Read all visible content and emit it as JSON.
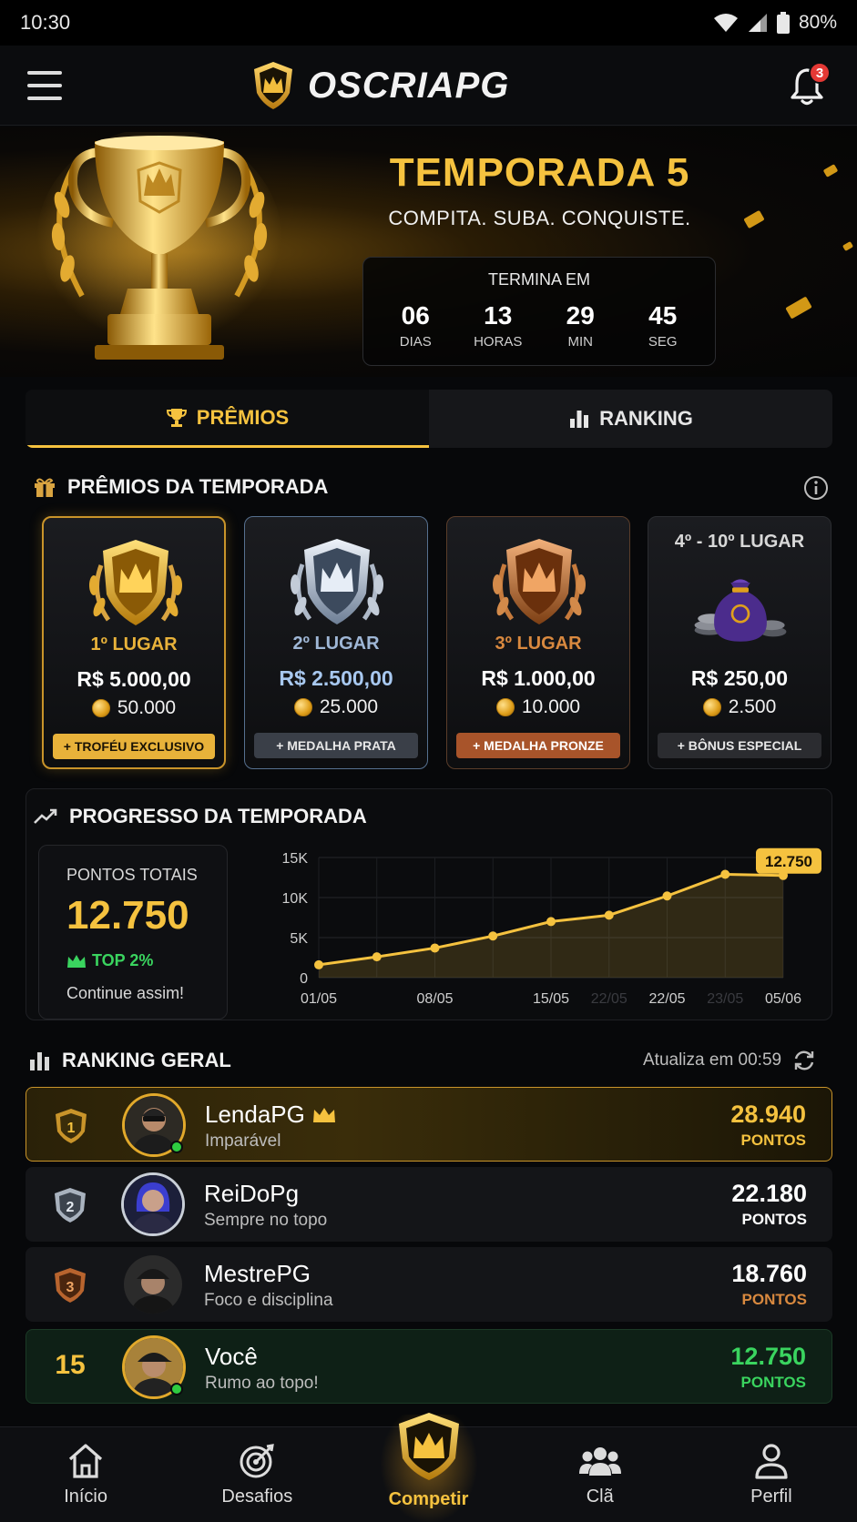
{
  "status_bar": {
    "time": "10:30",
    "battery": "80%"
  },
  "header": {
    "brand": "OSCRIAPG",
    "notifications": "3"
  },
  "hero": {
    "title": "TEMPORADA 5",
    "subtitle": "COMPITA. SUBA. CONQUISTE.",
    "countdown": {
      "label": "TERMINA EM",
      "units": [
        {
          "value": "06",
          "name": "DIAS"
        },
        {
          "value": "13",
          "name": "HORAS"
        },
        {
          "value": "29",
          "name": "MIN"
        },
        {
          "value": "45",
          "name": "SEG"
        }
      ]
    }
  },
  "tabs": [
    {
      "label": "PRÊMIOS",
      "active": true
    },
    {
      "label": "RANKING",
      "active": false
    }
  ],
  "prizes": {
    "title": "PRÊMIOS DA TEMPORADA",
    "cards": [
      {
        "rank": "1º LUGAR",
        "money": "R$ 5.000,00",
        "coins": "50.000",
        "badge": "+ TROFÉU EXCLUSIVO",
        "rank_color": "#e8b23a",
        "money_color": "#ffffff"
      },
      {
        "rank": "2º LUGAR",
        "money": "R$ 2.500,00",
        "coins": "25.000",
        "badge": "+ MEDALHA PRATA",
        "rank_color": "#9fb7d6",
        "money_color": "#a8c8f0"
      },
      {
        "rank": "3º LUGAR",
        "money": "R$ 1.000,00",
        "coins": "10.000",
        "badge": "+ MEDALHA PRONZE",
        "rank_color": "#d9893f",
        "money_color": "#ffffff"
      },
      {
        "rank": "4º - 10º LUGAR",
        "money": "R$ 250,00",
        "coins": "2.500",
        "badge": "+ BÔNUS ESPECIAL",
        "rank_color": "#d8d8d8",
        "money_color": "#ffffff"
      }
    ]
  },
  "progress": {
    "title": "PROGRESSO DA TEMPORADA",
    "points_label": "PONTOS TOTAIS",
    "points_value": "12.750",
    "top": "TOP 2%",
    "message": "Continue assim!"
  },
  "chart_data": {
    "type": "area",
    "x_labels": [
      "01/05",
      "08/05",
      "15/05",
      "22/05",
      "05/06"
    ],
    "faded_x_labels": [
      "22/05",
      "23/05"
    ],
    "y_ticks": [
      "15K",
      "10K",
      "5K",
      "0"
    ],
    "ylim": [
      0,
      15000
    ],
    "values": [
      1600,
      2600,
      3700,
      5200,
      7000,
      7800,
      10200,
      12900,
      12750
    ],
    "callout": "12.750",
    "grid": true,
    "accent": "#f5c23f"
  },
  "ranking": {
    "title": "RANKING GERAL",
    "refresh": "Atualiza em 00:59",
    "rows": [
      {
        "position": "1",
        "name": "LendaPG",
        "tag": "Imparável",
        "points": "28.940",
        "points_label": "PONTOS",
        "points_color": "#f5c23f",
        "label_color": "#f5c23f"
      },
      {
        "position": "2",
        "name": "ReiDoPg",
        "tag": "Sempre no topo",
        "points": "22.180",
        "points_label": "PONTOS",
        "points_color": "#ffffff",
        "label_color": "#ffffff"
      },
      {
        "position": "3",
        "name": "MestrePG",
        "tag": "Foco e disciplina",
        "points": "18.760",
        "points_label": "PONTOS",
        "points_color": "#ffffff",
        "label_color": "#d9893f"
      },
      {
        "position": "15",
        "name": "Você",
        "tag": "Rumo ao topo!",
        "points": "12.750",
        "points_label": "PONTOS",
        "points_color": "#3ad45f",
        "label_color": "#3ad45f"
      }
    ]
  },
  "bottom_nav": [
    {
      "label": "Início",
      "icon": "home-icon"
    },
    {
      "label": "Desafios",
      "icon": "target-icon"
    },
    {
      "label": "Competir",
      "icon": "crown-icon",
      "active": true
    },
    {
      "label": "Clã",
      "icon": "group-icon"
    },
    {
      "label": "Perfil",
      "icon": "user-icon"
    }
  ]
}
